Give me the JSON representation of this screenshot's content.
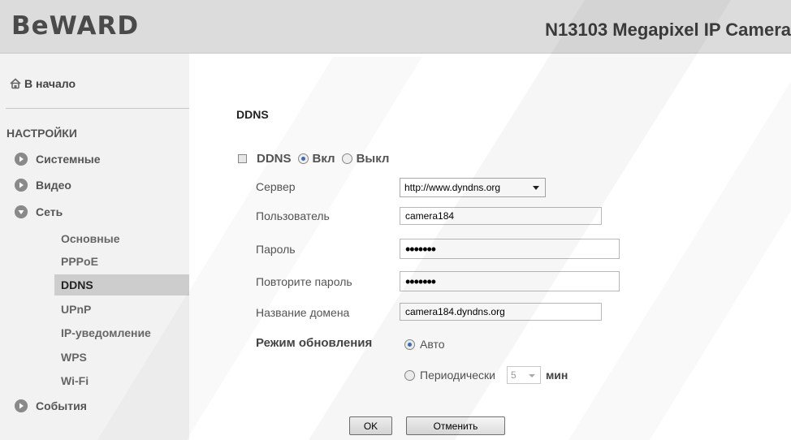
{
  "header": {
    "logo": "BeWARD",
    "product_title": "N13103 Megapixel IP Camera"
  },
  "sidebar": {
    "home_label": "В начало",
    "section_title": "НАСТРОЙКИ",
    "items": [
      {
        "label": "Системные",
        "expanded": false
      },
      {
        "label": "Видео",
        "expanded": false
      },
      {
        "label": "Сеть",
        "expanded": true
      },
      {
        "label": "События",
        "expanded": false
      }
    ],
    "network_subitems": [
      "Основные",
      "PPPoE",
      "DDNS",
      "UPnP",
      "IP-уведомление",
      "WPS",
      "Wi-Fi"
    ],
    "active_subitem": "DDNS",
    "icons": {
      "home": "home-icon",
      "collapsed": "arrow-right-icon",
      "expanded": "arrow-down-icon"
    }
  },
  "main": {
    "title": "DDNS",
    "ddns_toggle": {
      "label": "DDNS",
      "on_label": "Вкл",
      "off_label": "Выкл",
      "selected": "Вкл"
    },
    "server": {
      "label": "Сервер",
      "value": "http://www.dyndns.org"
    },
    "user": {
      "label": "Пользователь",
      "value": "camera184"
    },
    "password": {
      "label": "Пароль",
      "masked": "•••••••"
    },
    "password_repeat": {
      "label": "Повторите пароль",
      "masked": "•••••••"
    },
    "domain": {
      "label": "Название домена",
      "value": "camera184.dyndns.org"
    },
    "update_mode": {
      "label": "Режим обновления",
      "auto_label": "Авто",
      "periodic_label": "Периодически",
      "interval_value": "5",
      "interval_unit": "мин",
      "selected": "Авто"
    },
    "ok_label": "OK",
    "cancel_label": "Отменить"
  },
  "colors": {
    "header_bg": "#dcdcdc",
    "sidebar_bg": "#f2f2f2",
    "active_item_bg": "#cdcdcd",
    "radio_accent": "#3b6fb6"
  }
}
